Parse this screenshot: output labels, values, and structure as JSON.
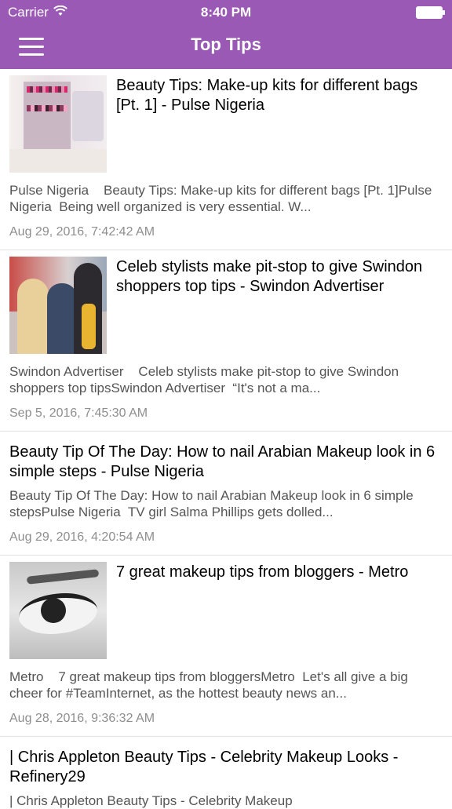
{
  "status_bar": {
    "carrier": "Carrier",
    "time": "8:40 PM",
    "wifi_icon": "wifi-icon",
    "battery_icon": "battery-icon"
  },
  "nav": {
    "title": "Top Tips",
    "menu_icon": "hamburger-menu-icon",
    "background": "#9b59b6"
  },
  "articles": [
    {
      "title": "Beauty Tips: Make-up kits for different bags [Pt. 1] - Pulse Nigeria",
      "description": "Pulse Nigeria    Beauty Tips: Make-up kits for different bags [Pt. 1]Pulse Nigeria  Being well organized is very essential. W...",
      "date": "Aug 29, 2016, 7:42:42 AM",
      "thumbnail": "makeup-organizer-image"
    },
    {
      "title": "Celeb stylists make pit-stop to give Swindon shoppers top tips - Swindon Advertiser",
      "description": "Swindon Advertiser    Celeb stylists make pit-stop to give Swindon shoppers top tipsSwindon Advertiser  “It's not a ma...",
      "date": "Sep 5, 2016, 7:45:30 AM",
      "thumbnail": "stylists-group-photo"
    },
    {
      "title": "Beauty Tip Of The Day: How to nail Arabian Makeup look in 6 simple steps - Pulse Nigeria",
      "description": "Beauty Tip Of The Day: How to nail Arabian Makeup look in 6 simple stepsPulse Nigeria  TV girl Salma Phillips gets dolled...",
      "date": "Aug 29, 2016, 4:20:54 AM",
      "thumbnail": null
    },
    {
      "title": "7 great makeup tips from bloggers - Metro",
      "description": "Metro    7 great makeup tips from bloggersMetro  Let's all give a big cheer for #TeamInternet, as the hottest beauty news an...",
      "date": "Aug 28, 2016, 9:36:32 AM",
      "thumbnail": "eyeliner-closeup-photo"
    },
    {
      "title": "| Chris Appleton Beauty Tips - Celebrity Makeup Looks - Refinery29",
      "description": "| Chris Appleton Beauty Tips - Celebrity Makeup",
      "date": "",
      "thumbnail": null
    }
  ]
}
